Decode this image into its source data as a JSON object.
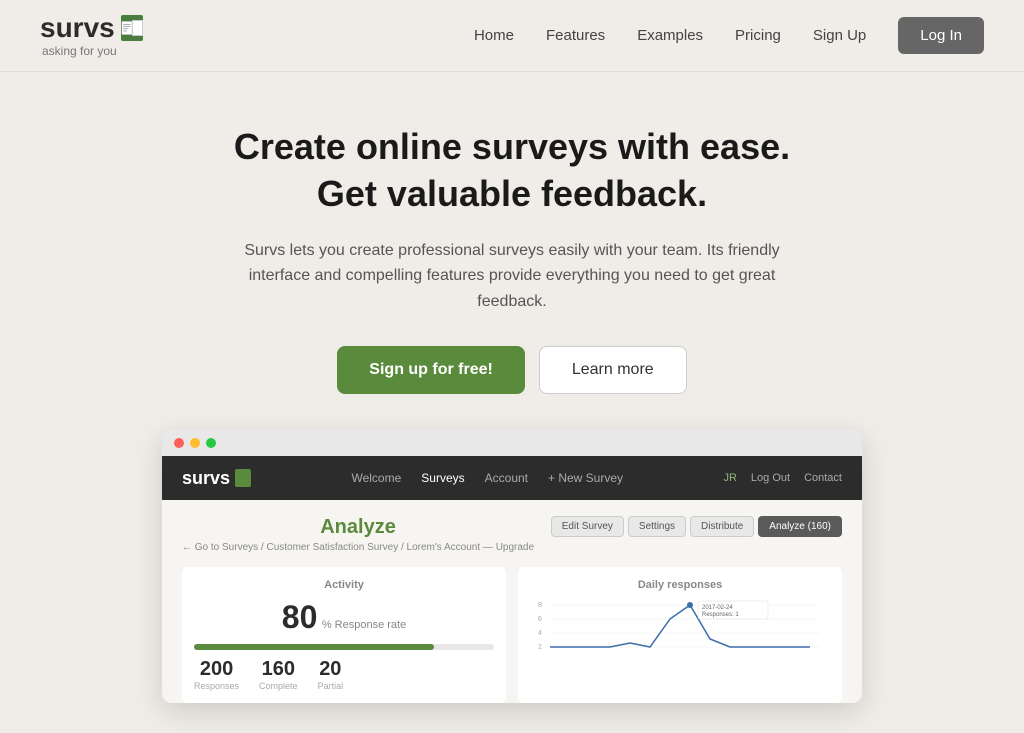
{
  "header": {
    "logo": {
      "name": "survs",
      "tagline": "asking for you"
    },
    "nav": {
      "links": [
        "Home",
        "Features",
        "Examples",
        "Pricing",
        "Sign Up"
      ],
      "login_label": "Log In"
    }
  },
  "hero": {
    "title_line1": "Create online surveys with ease.",
    "title_line2": "Get valuable feedback.",
    "subtitle": "Survs lets you create professional surveys easily with your team. Its friendly interface and compelling features provide everything you need to get great feedback.",
    "cta_primary": "Sign up for free!",
    "cta_secondary": "Learn more"
  },
  "app_preview": {
    "nav": {
      "logo": "survs",
      "links": [
        "Welcome",
        "Surveys",
        "Account",
        "+ New Survey"
      ],
      "right_links": [
        "JR",
        "Log Out",
        "Contact"
      ]
    },
    "analyze": {
      "title": "Analyze",
      "breadcrumb": "← Go to Surveys / Customer Satisfaction Survey / Lorem's Account — Upgrade",
      "buttons": [
        "Edit Survey",
        "Settings",
        "Distribute",
        "Analyze (160)"
      ],
      "activity": {
        "title": "Activity",
        "response_rate": "80",
        "response_rate_suffix": "% Response rate",
        "progress": 80,
        "stats": [
          {
            "value": "200",
            "label": "Responses"
          },
          {
            "value": "160",
            "label": "Complete"
          },
          {
            "value": "20",
            "label": "Partial"
          }
        ]
      },
      "daily": {
        "title": "Daily responses",
        "chart_label": "2017-02-24",
        "chart_sublabel": "Responses: 1"
      }
    }
  },
  "colors": {
    "brand_green": "#5a8a3c",
    "dark_bg": "#2c2c2c",
    "page_bg": "#f0ede8"
  }
}
